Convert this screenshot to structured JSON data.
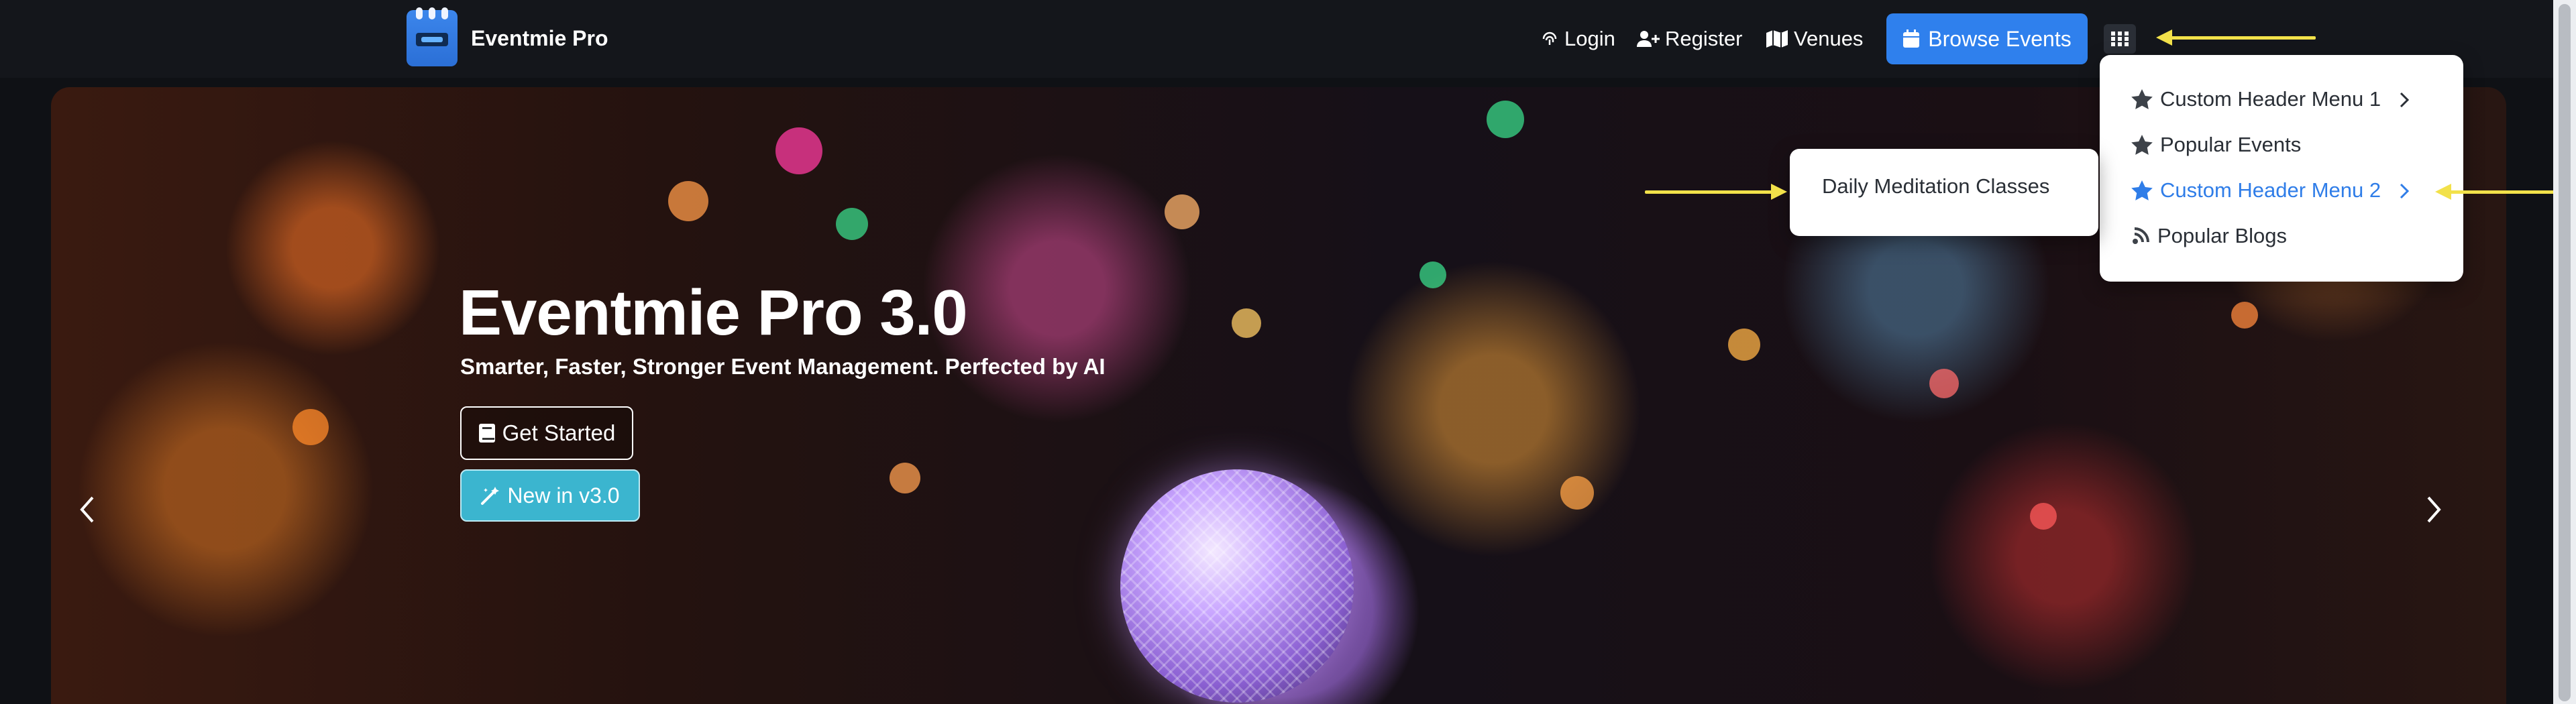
{
  "brand": {
    "name": "Eventmie Pro"
  },
  "nav": {
    "login": "Login",
    "register": "Register",
    "venues": "Venues",
    "browse_events": "Browse Events"
  },
  "hero": {
    "title": "Eventmie Pro 3.0",
    "subtitle": "Smarter, Faster, Stronger Event Management. Perfected by AI",
    "get_started": "Get Started",
    "new_in": "New in v3.0"
  },
  "dropdown": {
    "items": [
      {
        "label": "Custom Header Menu 1",
        "icon": "star-icon",
        "has_submenu": true,
        "active": false
      },
      {
        "label": "Popular Events",
        "icon": "star-icon",
        "has_submenu": false,
        "active": false
      },
      {
        "label": "Custom Header Menu 2",
        "icon": "star-icon",
        "has_submenu": true,
        "active": true
      },
      {
        "label": "Popular Blogs",
        "icon": "blog-icon",
        "has_submenu": false,
        "active": false
      }
    ]
  },
  "submenu": {
    "items": [
      {
        "label": "Daily Meditation Classes"
      }
    ]
  },
  "colors": {
    "accent": "#2f80ed",
    "active_menu": "#2f7de8",
    "new_button": "#3bb5cf",
    "annotation_arrow": "#f2e14a",
    "navbar": "#14161b"
  }
}
